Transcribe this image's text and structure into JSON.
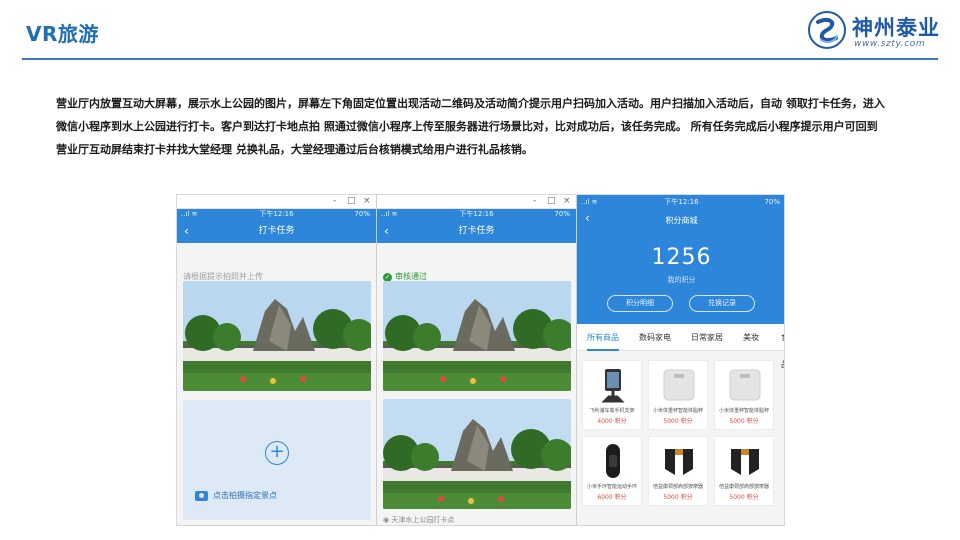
{
  "slide": {
    "title": "VR旅游"
  },
  "logo": {
    "name": "神州泰业",
    "url": "www.szty.com"
  },
  "intro": "营业厅内放置互动大屏幕，展示水上公园的图片，屏幕左下角固定位置出现活动二维码及活动简介提示用户扫码加入活动。用户扫描加入活动后，自动 领取打卡任务，进入微信小程序到水上公园进行打卡。客户到达打卡地点拍 照通过微信小程序上传至服务器进行场景比对，比对成功后，该任务完成。 所有任务完成后小程序提示用户可回到营业厅互动屏结束打卡并找大堂经理 兑换礼品，大堂经理通过后台核销模式给用户进行礼品核销。",
  "colors": {
    "accent": "#2d86d9",
    "title": "#1f6fb5",
    "success": "#2a9b35",
    "price": "#e04b3c"
  },
  "screens": [
    {
      "window_controls": [
        "-",
        "□",
        "×"
      ],
      "status": {
        "signal": "..ıl ≋",
        "time": "下午12:16",
        "battery": "70%"
      },
      "nav_title": "打卡任务",
      "back_icon": "‹",
      "hint": "请根据提示拍照并上传",
      "upload_icon": "+",
      "upload_label": "点击拍摄指定景点"
    },
    {
      "window_controls": [
        "-",
        "□",
        "×"
      ],
      "status": {
        "signal": "..ıl ≋",
        "time": "下午12:16",
        "battery": "70%"
      },
      "nav_title": "打卡任务",
      "back_icon": "‹",
      "pass_label": "审核通过",
      "location": "◉ 天津水上公园打卡点"
    },
    {
      "status": {
        "signal": "..ıl ≋",
        "time": "下午12:16",
        "battery": "70%"
      },
      "nav_title": "积分商城",
      "back_icon": "‹",
      "points_value": "1256",
      "points_label": "我的积分",
      "buttons": [
        "积分明细",
        "兑换记录"
      ],
      "tabs": [
        "所有商品",
        "数码家电",
        "日常家居",
        "美妆",
        "食品"
      ],
      "products": [
        {
          "name": "飞利浦车载手机支架",
          "price": "4000 积分",
          "icon": "car-phone-holder-icon"
        },
        {
          "name": "小米体重秤智能体脂秤",
          "price": "5000 积分",
          "icon": "scale-icon"
        },
        {
          "name": "小米体重秤智能体脂秤",
          "price": "5000 积分",
          "icon": "scale-icon"
        },
        {
          "name": "小米手环智能运动手环",
          "price": "6000 积分",
          "icon": "band-icon"
        },
        {
          "name": "倍益康颈部肩部按摩器",
          "price": "5000 积分",
          "icon": "massager-icon"
        },
        {
          "name": "倍益康颈部肩部按摩器",
          "price": "5000 积分",
          "icon": "massager-icon"
        }
      ]
    }
  ]
}
